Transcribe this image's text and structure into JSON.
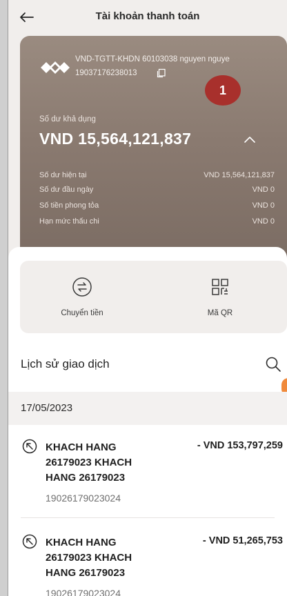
{
  "header": {
    "title": "Tài khoản thanh toán"
  },
  "account": {
    "name": "VND-TGTT-KHDN 60103038 nguyen nguye",
    "number": "19037176238013",
    "badge": "1",
    "available_label": "Số dư khả dụng",
    "available_value": "VND 15,564,121,837",
    "details": [
      {
        "label": "Số dư hiện tại",
        "value": "VND 15,564,121,837"
      },
      {
        "label": "Số dư đầu ngày",
        "value": "VND 0"
      },
      {
        "label": "Số tiền phong tỏa",
        "value": "VND 0"
      },
      {
        "label": "Hạn mức thấu chi",
        "value": "VND 0"
      }
    ]
  },
  "actions": [
    {
      "label": "Chuyển tiền",
      "icon": "transfer-icon"
    },
    {
      "label": "Mã QR",
      "icon": "qr-icon"
    }
  ],
  "history": {
    "title": "Lịch sử giao dịch",
    "date": "17/05/2023",
    "transactions": [
      {
        "name": "KHACH HANG 26179023 KHACH HANG 26179023",
        "amount": "- VND 153,797,259",
        "ref": "19026179023024"
      },
      {
        "name": "KHACH HANG 26179023 KHACH HANG 26179023",
        "amount": "- VND 51,265,753",
        "ref": "19026179023024"
      }
    ]
  },
  "colors": {
    "card": "#8a7a70",
    "badge": "#a8302c",
    "accent": "#f08a3c"
  }
}
